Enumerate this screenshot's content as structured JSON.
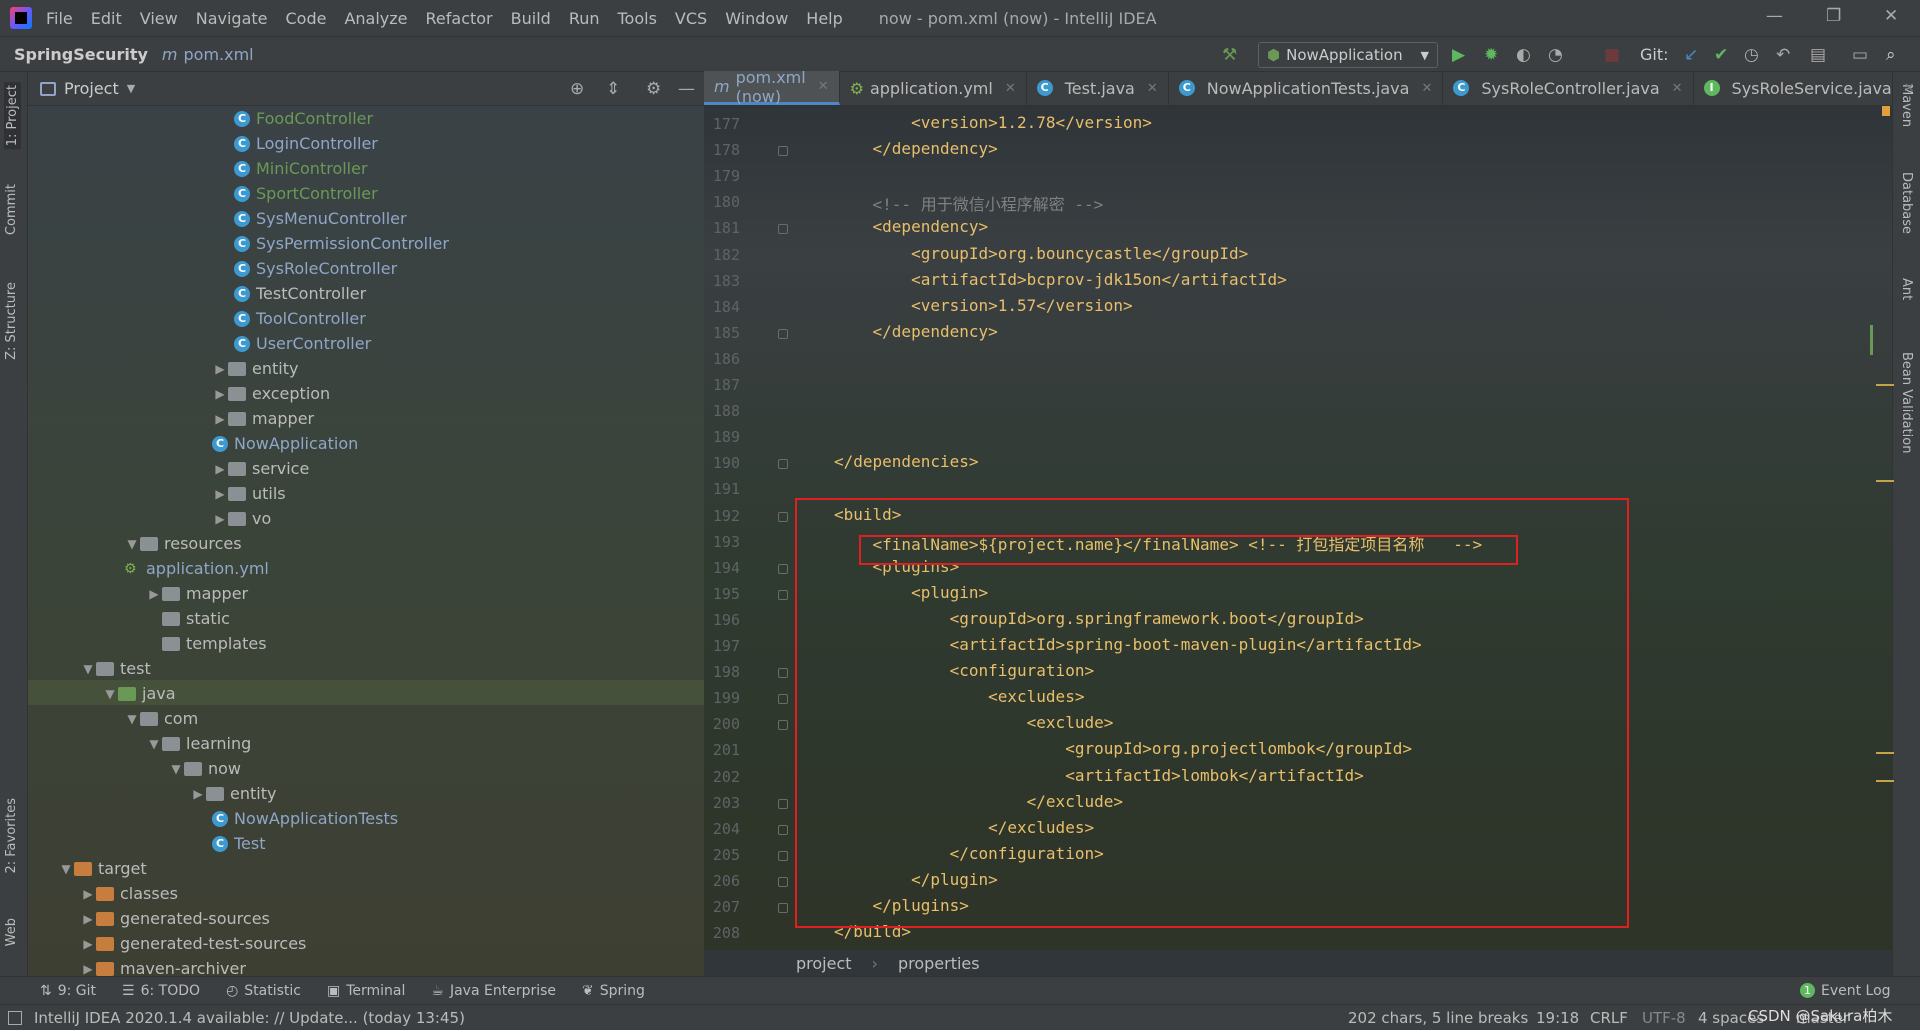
{
  "menu": [
    "File",
    "Edit",
    "View",
    "Navigate",
    "Code",
    "Analyze",
    "Refactor",
    "Build",
    "Run",
    "Tools",
    "VCS",
    "Window",
    "Help"
  ],
  "window_title": "now - pom.xml (now) - IntelliJ IDEA",
  "nav": {
    "project": "SpringSecurity",
    "file": "pom.xml",
    "file_prefix": "m"
  },
  "run_config": "NowApplication",
  "git_label": "Git:",
  "left_tabs": [
    "1: Project",
    "Commit",
    "Z: Structure",
    "2: Favorites",
    "Web"
  ],
  "right_tabs": [
    "Maven",
    "Database",
    "Ant",
    "Bean Validation"
  ],
  "project_panel_title": "Project",
  "tree": [
    {
      "label": "FoodController",
      "indent": 0,
      "type": "class",
      "color": "#6a9955"
    },
    {
      "label": "LoginController",
      "indent": 0,
      "type": "class",
      "color": "#8fa6c7"
    },
    {
      "label": "MiniController",
      "indent": 0,
      "type": "class",
      "color": "#6a9955"
    },
    {
      "label": "SportController",
      "indent": 0,
      "type": "class",
      "color": "#6a9955"
    },
    {
      "label": "SysMenuController",
      "indent": 0,
      "type": "class",
      "color": "#8fa6c7"
    },
    {
      "label": "SysPermissionController",
      "indent": 0,
      "type": "class",
      "color": "#8fa6c7"
    },
    {
      "label": "SysRoleController",
      "indent": 0,
      "type": "class",
      "color": "#8fa6c7"
    },
    {
      "label": "TestController",
      "indent": 0,
      "type": "class",
      "color": "#bbbbbb"
    },
    {
      "label": "ToolController",
      "indent": 0,
      "type": "class",
      "color": "#8fa6c7"
    },
    {
      "label": "UserController",
      "indent": 0,
      "type": "class",
      "color": "#8fa6c7"
    },
    {
      "label": "entity",
      "indent": -1,
      "type": "folder",
      "color": "#bbbbbb",
      "tri": "▶"
    },
    {
      "label": "exception",
      "indent": -1,
      "type": "folder",
      "color": "#bbbbbb",
      "tri": "▶"
    },
    {
      "label": "mapper",
      "indent": -1,
      "type": "folder",
      "color": "#bbbbbb",
      "tri": "▶"
    },
    {
      "label": "NowApplication",
      "indent": -1,
      "type": "class",
      "color": "#8fa6c7"
    },
    {
      "label": "service",
      "indent": -1,
      "type": "folder",
      "color": "#bbbbbb",
      "tri": "▶"
    },
    {
      "label": "utils",
      "indent": -1,
      "type": "folder",
      "color": "#bbbbbb",
      "tri": "▶"
    },
    {
      "label": "vo",
      "indent": -1,
      "type": "folder",
      "color": "#bbbbbb",
      "tri": "▶"
    },
    {
      "label": "resources",
      "indent": -5,
      "type": "folder",
      "color": "#bbbbbb",
      "tri": "▼"
    },
    {
      "label": "application.yml",
      "indent": -5,
      "type": "yml",
      "color": "#8fa6c7"
    },
    {
      "label": "mapper",
      "indent": -4,
      "type": "folder",
      "color": "#bbbbbb",
      "tri": "▶"
    },
    {
      "label": "static",
      "indent": -4,
      "type": "folder",
      "color": "#bbbbbb"
    },
    {
      "label": "templates",
      "indent": -4,
      "type": "folder",
      "color": "#bbbbbb"
    },
    {
      "label": "test",
      "indent": -7,
      "type": "folder",
      "color": "#bbbbbb",
      "tri": "▼"
    },
    {
      "label": "java",
      "indent": -6,
      "type": "folder-green",
      "color": "#bbbbbb",
      "tri": "▼"
    },
    {
      "label": "com",
      "indent": -5,
      "type": "folder",
      "color": "#bbbbbb",
      "tri": "▼"
    },
    {
      "label": "learning",
      "indent": -4,
      "type": "folder",
      "color": "#bbbbbb",
      "tri": "▼"
    },
    {
      "label": "now",
      "indent": -3,
      "type": "folder",
      "color": "#bbbbbb",
      "tri": "▼"
    },
    {
      "label": "entity",
      "indent": -2,
      "type": "folder",
      "color": "#bbbbbb",
      "tri": "▶"
    },
    {
      "label": "NowApplicationTests",
      "indent": -1,
      "type": "class",
      "color": "#8fa6c7"
    },
    {
      "label": "Test",
      "indent": -1,
      "type": "class",
      "color": "#8fa6c7"
    },
    {
      "label": "target",
      "indent": -8,
      "type": "folder-orange",
      "color": "#bbbbbb",
      "tri": "▼"
    },
    {
      "label": "classes",
      "indent": -7,
      "type": "folder-orange",
      "color": "#bbbbbb",
      "tri": "▶"
    },
    {
      "label": "generated-sources",
      "indent": -7,
      "type": "folder-orange",
      "color": "#bbbbbb",
      "tri": "▶"
    },
    {
      "label": "generated-test-sources",
      "indent": -7,
      "type": "folder-orange",
      "color": "#bbbbbb",
      "tri": "▶"
    },
    {
      "label": "maven-archiver",
      "indent": -7,
      "type": "folder-orange",
      "color": "#bbbbbb",
      "tri": "▶"
    }
  ],
  "tabs": [
    {
      "label": "pom.xml (now)",
      "icon": "m",
      "active": true
    },
    {
      "label": "application.yml",
      "icon": "yml"
    },
    {
      "label": "Test.java",
      "icon": "c"
    },
    {
      "label": "NowApplicationTests.java",
      "icon": "c"
    },
    {
      "label": "SysRoleController.java",
      "icon": "c"
    },
    {
      "label": "SysRoleService.java",
      "icon": "i"
    }
  ],
  "code": [
    {
      "n": "177",
      "text": "        <version>1.2.78</version>"
    },
    {
      "n": "178",
      "text": "    </dependency>"
    },
    {
      "n": "179",
      "text": ""
    },
    {
      "n": "180",
      "text": "    <!-- 用于微信小程序解密 -->",
      "comment": true
    },
    {
      "n": "181",
      "text": "    <dependency>"
    },
    {
      "n": "182",
      "text": "        <groupId>org.bouncycastle</groupId>"
    },
    {
      "n": "183",
      "text": "        <artifactId>bcprov-jdk15on</artifactId>"
    },
    {
      "n": "184",
      "text": "        <version>1.57</version>"
    },
    {
      "n": "185",
      "text": "    </dependency>"
    },
    {
      "n": "186",
      "text": ""
    },
    {
      "n": "187",
      "text": ""
    },
    {
      "n": "188",
      "text": ""
    },
    {
      "n": "189",
      "text": ""
    },
    {
      "n": "190",
      "text": "</dependencies>"
    },
    {
      "n": "191",
      "text": ""
    },
    {
      "n": "192",
      "text": "<build>"
    },
    {
      "n": "193",
      "text": "    <finalName>${project.name}</finalName> <!-- 打包指定项目名称   -->"
    },
    {
      "n": "194",
      "text": "    <plugins>"
    },
    {
      "n": "195",
      "text": "        <plugin>"
    },
    {
      "n": "196",
      "text": "            <groupId>org.springframework.boot</groupId>"
    },
    {
      "n": "197",
      "text": "            <artifactId>spring-boot-maven-plugin</artifactId>"
    },
    {
      "n": "198",
      "text": "            <configuration>"
    },
    {
      "n": "199",
      "text": "                <excludes>"
    },
    {
      "n": "200",
      "text": "                    <exclude>"
    },
    {
      "n": "201",
      "text": "                        <groupId>org.projectlombok</groupId>"
    },
    {
      "n": "202",
      "text": "                        <artifactId>lombok</artifactId>"
    },
    {
      "n": "203",
      "text": "                    </exclude>"
    },
    {
      "n": "204",
      "text": "                </excludes>"
    },
    {
      "n": "205",
      "text": "            </configuration>"
    },
    {
      "n": "206",
      "text": "        </plugin>"
    },
    {
      "n": "207",
      "text": "    </plugins>"
    },
    {
      "n": "208",
      "text": "</build>"
    }
  ],
  "editor_breadcrumb": [
    "project",
    "properties"
  ],
  "tool_windows": [
    "9: Git",
    "6: TODO",
    "Statistic",
    "Terminal",
    "Java Enterprise",
    "Spring"
  ],
  "event_log": "Event Log",
  "event_count": "1",
  "status": {
    "message": "IntelliJ IDEA 2020.1.4 available: // Update... (today 13:45)",
    "chars": "202 chars, 5 line breaks",
    "position": "19:18",
    "line_sep": "CRLF",
    "encoding": "UTF-8",
    "indent": "4 spaces",
    "branch": "master",
    "watermark": "CSDN @Sakura柏木"
  }
}
